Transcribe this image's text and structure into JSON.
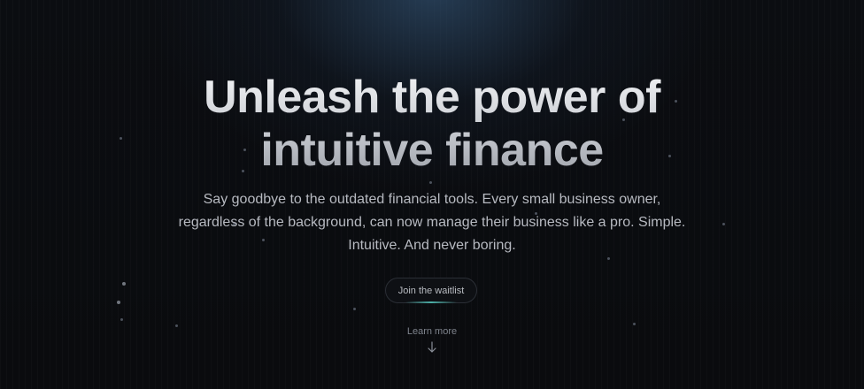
{
  "hero": {
    "headline_line1": "Unleash the power of",
    "headline_line2": "intuitive finance",
    "subtitle_line1": "Say goodbye to the outdated financial tools. Every small business owner,",
    "subtitle_line2": "regardless of the background, can now manage their business like a pro. Simple.",
    "subtitle_line3": "Intuitive. And never boring.",
    "cta_label": "Join the waitlist",
    "learn_more_label": "Learn more",
    "learn_more_icon": "arrow-down-icon"
  },
  "colors": {
    "background": "#0a0b0e",
    "glow": "#3c648c",
    "cta_accent": "#50beb4",
    "subtitle_text": "#b7bac1"
  }
}
